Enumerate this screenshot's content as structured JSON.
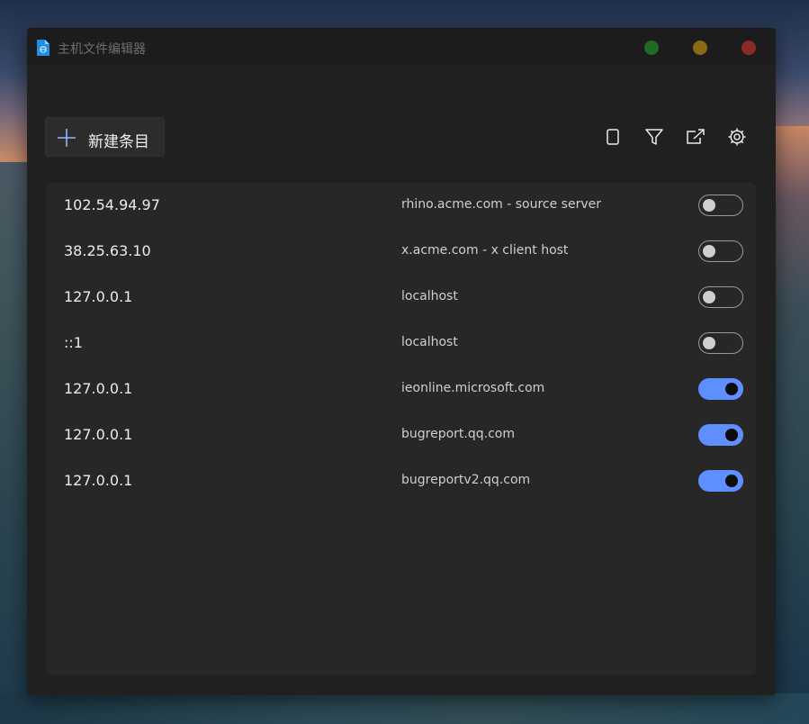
{
  "window": {
    "title": "主机文件编辑器",
    "controls": {
      "green_color": "#1f6a25",
      "yellow_color": "#8a6a16",
      "red_color": "#8c2a2a"
    }
  },
  "toolbar": {
    "new_entry_label": "新建条目",
    "icons": [
      "plus-icon",
      "document-icon",
      "filter-icon",
      "export-icon",
      "gear-icon"
    ]
  },
  "accent_color": "#5f8fff",
  "entries": [
    {
      "ip": "102.54.94.97",
      "host": "rhino.acme.com - source server",
      "enabled": false
    },
    {
      "ip": "38.25.63.10",
      "host": "x.acme.com - x client host",
      "enabled": false
    },
    {
      "ip": "127.0.0.1",
      "host": "localhost",
      "enabled": false
    },
    {
      "ip": "::1",
      "host": "localhost",
      "enabled": false
    },
    {
      "ip": "127.0.0.1",
      "host": "ieonline.microsoft.com",
      "enabled": true
    },
    {
      "ip": "127.0.0.1",
      "host": "bugreport.qq.com",
      "enabled": true
    },
    {
      "ip": "127.0.0.1",
      "host": "bugreportv2.qq.com",
      "enabled": true
    }
  ]
}
